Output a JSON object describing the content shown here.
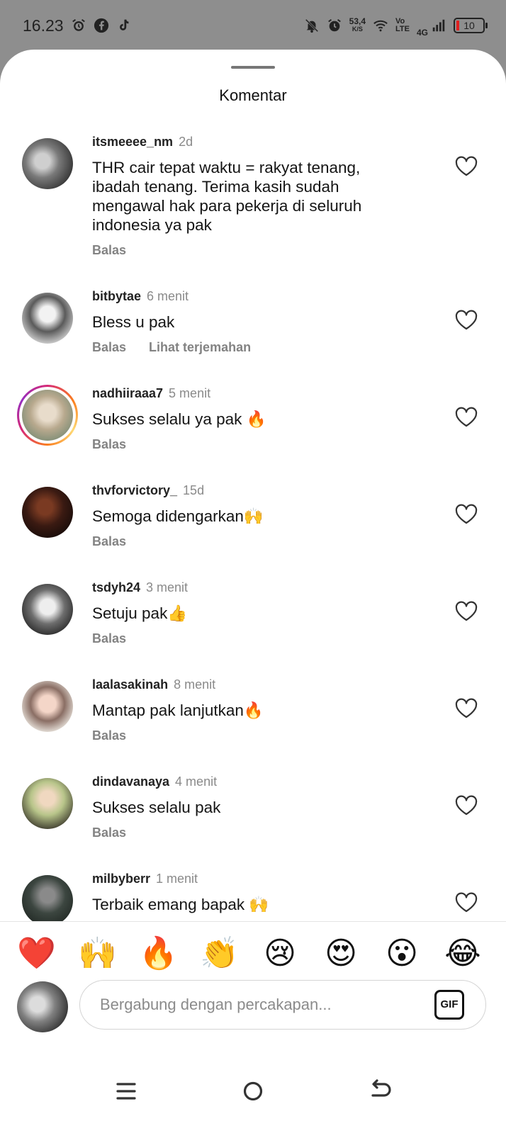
{
  "status_bar": {
    "time": "16.23",
    "net_speed": "53,4",
    "net_unit": "K/S",
    "volte_top": "Vo",
    "volte_bottom": "LTE",
    "network": "4G",
    "battery": "10"
  },
  "sheet": {
    "title": "Komentar"
  },
  "comments": [
    {
      "username": "itsmeeee_nm",
      "time": "2d",
      "text": "THR cair tepat waktu = rakyat tenang, ibadah tenang. Terima kasih sudah mengawal hak para pekerja di seluruh indonesia ya pak",
      "reply": "Balas",
      "translate": ""
    },
    {
      "username": "bitbytae",
      "time": "6 menit",
      "text": "Bless u pak",
      "reply": "Balas",
      "translate": "Lihat terjemahan"
    },
    {
      "username": "nadhiiraaa7",
      "time": "5 menit",
      "text": "Sukses selalu ya pak 🔥",
      "reply": "Balas",
      "translate": ""
    },
    {
      "username": "thvforvictory_",
      "time": "15d",
      "text": "Semoga didengarkan🙌",
      "reply": "Balas",
      "translate": ""
    },
    {
      "username": "tsdyh24",
      "time": "3 menit",
      "text": "Setuju pak👍",
      "reply": "Balas",
      "translate": ""
    },
    {
      "username": "laalasakinah",
      "time": "8 menit",
      "text": "Mantap pak lanjutkan🔥",
      "reply": "Balas",
      "translate": ""
    },
    {
      "username": "dindavanaya",
      "time": "4 menit",
      "text": "Sukses selalu pak",
      "reply": "Balas",
      "translate": ""
    },
    {
      "username": "milbyberr",
      "time": "1 menit",
      "text": "Terbaik emang bapak 🙌",
      "reply": "",
      "translate": ""
    }
  ],
  "reactions": [
    "❤️",
    "🙌",
    "🔥",
    "👏",
    "😢",
    "😍",
    "😮",
    "😂"
  ],
  "composer": {
    "placeholder": "Bergabung dengan percakapan...",
    "gif_label": "GIF"
  },
  "colors": {
    "heart_stroke": "#333333",
    "muted_text": "#838383",
    "story_ring": "#d62976"
  }
}
